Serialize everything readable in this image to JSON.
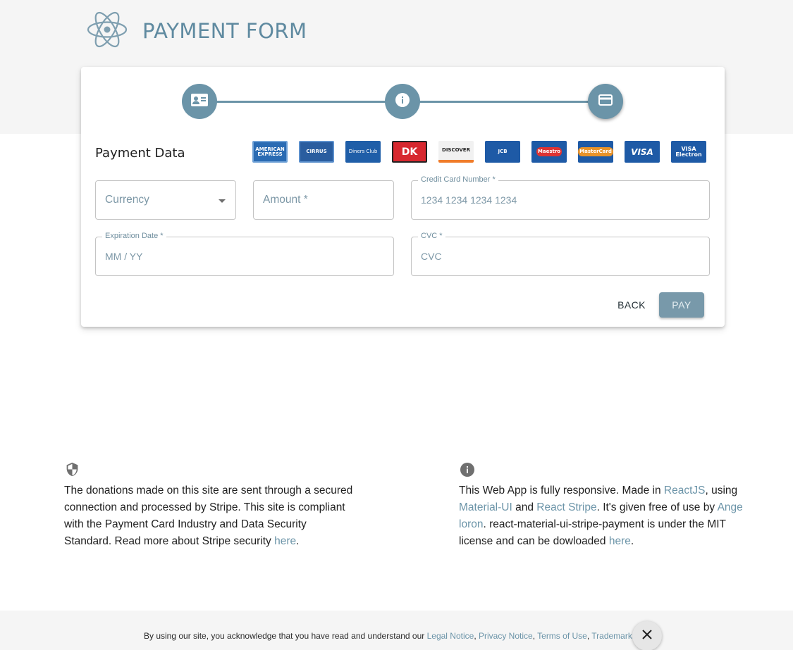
{
  "header": {
    "title": "PAYMENT FORM",
    "logo_icon": "react-atom-icon"
  },
  "stepper": {
    "steps": [
      {
        "icon": "contact-card-icon",
        "state": "done"
      },
      {
        "icon": "info-icon",
        "state": "done"
      },
      {
        "icon": "credit-card-icon",
        "state": "active"
      }
    ],
    "color": "#6b94a8"
  },
  "payment": {
    "section_title": "Payment Data",
    "card_brands": [
      {
        "label": "AMERICAN EXPRESS",
        "color": "#2a6bb3"
      },
      {
        "label": "CIRRUS",
        "color": "#2a5d9f"
      },
      {
        "label": "Diners Club",
        "color": "#1f5ea8"
      },
      {
        "label": "DK",
        "color": "#d7282f"
      },
      {
        "label": "DISCOVER",
        "color": "#f1f1f1"
      },
      {
        "label": "JCB",
        "color": "#1e5aa6"
      },
      {
        "label": "Maestro",
        "color": "#1e5aa6"
      },
      {
        "label": "MasterCard",
        "color": "#1e5aa6"
      },
      {
        "label": "VISA",
        "color": "#1e5aa6"
      },
      {
        "label": "VISA Electron",
        "color": "#1e5aa6"
      }
    ],
    "currency": {
      "placeholder": "Currency"
    },
    "amount": {
      "placeholder": "Amount *"
    },
    "card_number": {
      "label": "Credit Card Number *",
      "placeholder": "1234 1234 1234 1234"
    },
    "expiration": {
      "label": "Expiration Date *",
      "placeholder": "MM / YY"
    },
    "cvc": {
      "label": "CVC *",
      "placeholder": "CVC"
    },
    "back_label": "BACK",
    "pay_label": "PAY"
  },
  "info_left": {
    "icon": "shield-icon",
    "text": "The donations made on this site are sent through a secured connection and processed by Stripe. This site is compliant with the Payment Card Industry and Data Security Standard. Read more about Stripe security ",
    "link": "here",
    "end": "."
  },
  "info_right": {
    "icon": "info-icon",
    "t1": "This Web App is fully responsive. Made in ",
    "l1": "ReactJS",
    "t2": ", using ",
    "l2": "Material-UI",
    "t3": " and ",
    "l3": "React Stripe",
    "t4": ". It's given free of use by ",
    "l4": "Ange loron",
    "t5": ". react-material-ui-stripe-payment is under the MIT license and can be dowloaded ",
    "l5": "here",
    "t6": "."
  },
  "cookie": {
    "text": "By using our site, you acknowledge that you have read and understand our ",
    "links": [
      "Legal Notice",
      "Privacy Notice",
      "Terms of Use",
      "Trademarks"
    ],
    "sep": ", ",
    "close_icon": "close-icon"
  }
}
